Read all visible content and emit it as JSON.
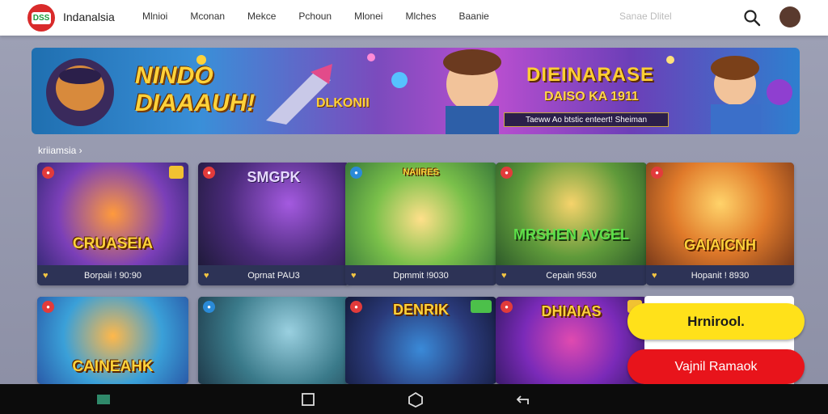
{
  "header": {
    "brand": "Indanalsia",
    "logo_text": "DSS",
    "nav": [
      "Mlnioi",
      "Mconan",
      "Mekce",
      "Pchoun",
      "Mlonei",
      "Mlches",
      "Baanie"
    ],
    "search_hint": "Sanae Dlitel",
    "icons": {
      "search": "search-icon",
      "avatar": "avatar-icon"
    }
  },
  "banner": {
    "title": "NINDO DIAAAUH!",
    "mid_text": "DLKONII",
    "right_title": "DIEINARASE",
    "right_sub": "DAISO KA 1911",
    "strip_text": "Taeww Ao btstic enteert! Sheiman"
  },
  "section": {
    "label": "kriiamsia ›"
  },
  "cards": [
    {
      "title": "CRUASEIA",
      "footer": "Borpaii ! 90:90"
    },
    {
      "title": "SMGPK",
      "footer": "Oprnat PAU3"
    },
    {
      "title": "NAIIRES",
      "footer": "Dpmmit !9030"
    },
    {
      "title": "MRSHEN AVGEL",
      "footer": "Cepain 9530"
    },
    {
      "title": "GAIAICNH",
      "footer": "Hopanit ! 8930"
    },
    {
      "title": "CAINEAHK",
      "footer": ""
    },
    {
      "title": "",
      "footer": ""
    },
    {
      "title": "DENRIK",
      "footer": ""
    },
    {
      "title": "DHIAIAS",
      "footer": ""
    }
  ],
  "actions": {
    "primary": "Hrnirool.",
    "secondary": "Vajnil Ramaok"
  },
  "colors": {
    "accent_yellow": "#ffe11a",
    "accent_red": "#e8141b",
    "card_footer": "#2d3356"
  },
  "system_nav": {
    "icons": [
      "recent-apps-icon",
      "overview-icon",
      "home-icon",
      "back-icon"
    ]
  }
}
